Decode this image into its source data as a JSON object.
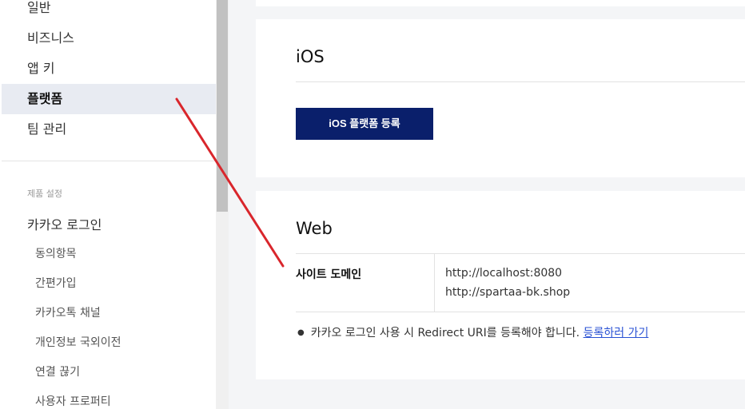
{
  "sidebar": {
    "items": [
      {
        "label": "일반"
      },
      {
        "label": "비즈니스"
      },
      {
        "label": "앱 키"
      },
      {
        "label": "플랫폼"
      },
      {
        "label": "팀 관리"
      }
    ],
    "active_item": "플랫폼",
    "product_section_label": "제품 설정",
    "product": "카카오 로그인",
    "sub_items": [
      {
        "label": "동의항목"
      },
      {
        "label": "간편가입"
      },
      {
        "label": "카카오톡 채널"
      },
      {
        "label": "개인정보 국외이전"
      },
      {
        "label": "연결 끊기"
      },
      {
        "label": "사용자 프로퍼티"
      }
    ]
  },
  "ios": {
    "title": "iOS",
    "register_button": "iOS 플랫폼 등록"
  },
  "web": {
    "title": "Web",
    "domain_label": "사이트 도메인",
    "domains": [
      "http://localhost:8080",
      "http://spartaa-bk.shop"
    ],
    "note_text": "카카오 로그인 사용 시 Redirect URI를 등록해야 합니다.",
    "note_link": "등록하러 가기"
  },
  "colors": {
    "primary_button": "#0a1f6b",
    "link": "#2a52d4",
    "active_nav_bg": "#e8ebf2",
    "annotation_arrow": "#d9262c"
  }
}
